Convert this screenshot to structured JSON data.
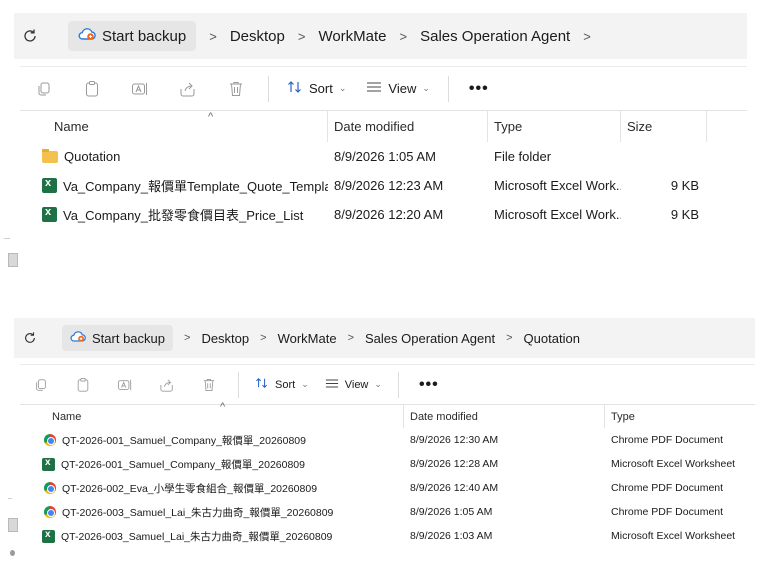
{
  "panel1": {
    "backup_label": "Start backup",
    "breadcrumbs": [
      "Desktop",
      "WorkMate",
      "Sales Operation Agent"
    ],
    "toolbar": {
      "sort_label": "Sort",
      "view_label": "View",
      "more_label": "•••"
    },
    "columns": {
      "name": "Name",
      "date": "Date modified",
      "type": "Type",
      "size": "Size"
    },
    "rows": [
      {
        "name": "Quotation",
        "date": "8/9/2026 1:05 AM",
        "type": "File folder",
        "size": "",
        "icon": "folder-icon"
      },
      {
        "name": "Va_Company_報價單Template_Quote_Template",
        "date": "8/9/2026 12:23 AM",
        "type": "Microsoft Excel Work...",
        "size": "9 KB",
        "icon": "excel-icon"
      },
      {
        "name": "Va_Company_批發零食價目表_Price_List",
        "date": "8/9/2026 12:20 AM",
        "type": "Microsoft Excel Work...",
        "size": "9 KB",
        "icon": "excel-icon"
      }
    ]
  },
  "panel2": {
    "backup_label": "Start backup",
    "breadcrumbs": [
      "Desktop",
      "WorkMate",
      "Sales Operation Agent",
      "Quotation"
    ],
    "toolbar": {
      "sort_label": "Sort",
      "view_label": "View",
      "more_label": "•••"
    },
    "columns": {
      "name": "Name",
      "date": "Date modified",
      "type": "Type"
    },
    "rows": [
      {
        "name": "QT-2026-001_Samuel_Company_報價單_20260809",
        "date": "8/9/2026 12:30 AM",
        "type": "Chrome PDF Document",
        "icon": "chrome-pdf-icon"
      },
      {
        "name": "QT-2026-001_Samuel_Company_報價單_20260809",
        "date": "8/9/2026 12:28 AM",
        "type": "Microsoft Excel Worksheet",
        "icon": "excel-icon"
      },
      {
        "name": "QT-2026-002_Eva_小學生零食組合_報價單_20260809",
        "date": "8/9/2026 12:40 AM",
        "type": "Chrome PDF Document",
        "icon": "chrome-pdf-icon"
      },
      {
        "name": "QT-2026-003_Samuel_Lai_朱古力曲奇_報價單_20260809",
        "date": "8/9/2026 1:05 AM",
        "type": "Chrome PDF Document",
        "icon": "chrome-pdf-icon"
      },
      {
        "name": "QT-2026-003_Samuel_Lai_朱古力曲奇_報價單_20260809",
        "date": "8/9/2026 1:03 AM",
        "type": "Microsoft Excel Worksheet",
        "icon": "excel-icon"
      }
    ]
  }
}
